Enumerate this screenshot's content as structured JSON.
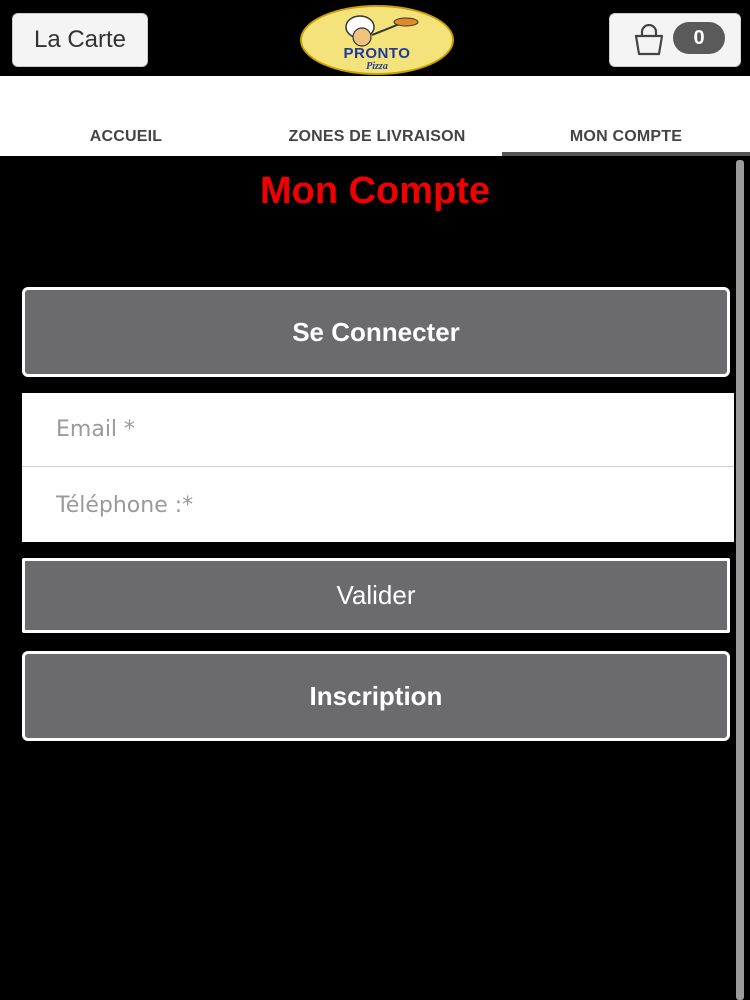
{
  "header": {
    "menu_button_label": "La Carte",
    "logo": {
      "name": "PRONTO",
      "tagline": "Pizza"
    },
    "cart": {
      "icon": "shopping-bag-icon",
      "count": "0"
    }
  },
  "nav": {
    "tabs": [
      {
        "label": "ACCUEIL"
      },
      {
        "label": "ZONES DE LIVRAISON"
      },
      {
        "label": "MON COMPTE",
        "active": true
      }
    ]
  },
  "main": {
    "title": "Mon Compte",
    "login_button": "Se Connecter",
    "form": {
      "email_placeholder": "Email *",
      "phone_placeholder": "Téléphone :*",
      "submit_label": "Valider"
    },
    "signup_button": "Inscription"
  },
  "colors": {
    "background": "#000000",
    "title": "#f20000",
    "button": "#6b6a6c",
    "badge": "#5a5a5a"
  }
}
